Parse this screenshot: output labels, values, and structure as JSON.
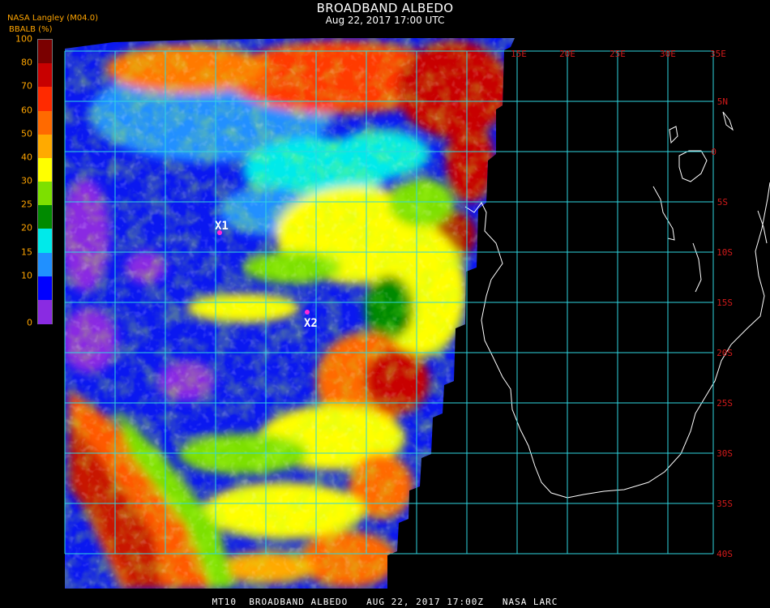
{
  "title": "BROADBAND ALBEDO",
  "subtitle": "Aug 22, 2017 17:00 UTC",
  "source": "NASA Langley (M04.0)",
  "colorbar": {
    "label": "BBALB (%)",
    "ticks": [
      "100",
      "80",
      "70",
      "60",
      "50",
      "40",
      "30",
      "25",
      "20",
      "15",
      "10",
      "0"
    ],
    "colors": [
      "#7a0000",
      "#c80000",
      "#ff2a00",
      "#ff6a00",
      "#ffaa00",
      "#ffff00",
      "#7de000",
      "#008a00",
      "#00eaea",
      "#2090ff",
      "#0000ff",
      "#8a2be2"
    ]
  },
  "grid": {
    "lon_labels": [
      "15E",
      "20E",
      "25E",
      "30E",
      "35E"
    ],
    "lat_labels": [
      "5N",
      "0",
      "5S",
      "10S",
      "15S",
      "20S",
      "25S",
      "30S",
      "35S",
      "40S"
    ],
    "line_color": "#2fd6e0"
  },
  "markers": [
    {
      "label": "X1",
      "color": "#ff2bd6"
    },
    {
      "label": "X2",
      "color": "#ff2bd6"
    }
  ],
  "footer": "MT10  BROADBAND ALBEDO   AUG 22, 2017 17:00Z   NASA LARC"
}
